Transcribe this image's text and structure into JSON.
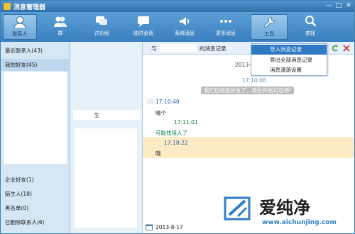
{
  "window": {
    "title": "消息管理器"
  },
  "toolbar": {
    "items": [
      {
        "label": "联系人",
        "icon": "contact-icon"
      },
      {
        "label": "群",
        "icon": "group-icon"
      },
      {
        "label": "讨论组",
        "icon": "discussion-icon"
      },
      {
        "label": "临时会话",
        "icon": "temp-chat-icon"
      },
      {
        "label": "系统消息",
        "icon": "speaker-icon"
      },
      {
        "label": "更多消息",
        "icon": "more-icon"
      },
      {
        "label": "工具",
        "icon": "wrench-icon"
      },
      {
        "label": "查找",
        "icon": "search-icon"
      }
    ]
  },
  "left": {
    "groups_top": [
      {
        "label": "最近联系人(43)"
      },
      {
        "label": "我的好友(45)"
      }
    ],
    "groups_bottom": [
      {
        "label": "企业好友(1)"
      },
      {
        "label": "陌生人(18)"
      },
      {
        "label": "黑名单(0)"
      },
      {
        "label": "已删除联系人(6)"
      }
    ]
  },
  "middle": {
    "contact_suffix": "生"
  },
  "right": {
    "header_prefix": "与",
    "header_suffix": "的消息记录",
    "date_top": "2013-",
    "messages": [
      {
        "time": "17:10:06"
      },
      {
        "system": "我们已经是好友了，现在开始对话吧!"
      },
      {
        "time": "17:10:40",
        "text": "哪个"
      },
      {
        "time": "17:11:01",
        "text": "可能找错人了"
      },
      {
        "time": "17:18:22",
        "text": "哦"
      }
    ],
    "date_bottom": "2013-8-17"
  },
  "tools_menu": {
    "items": [
      "导入消息记录",
      "导出全部消息记录",
      "消息漫游设置"
    ]
  },
  "watermark": {
    "brand": "爱纯净",
    "url": "www.aichunjing.com"
  },
  "colors": {
    "accent": "#3a7fbf",
    "highlight": "#fdebc4",
    "menu_highlight": "#2f79c4",
    "time_green": "#0a7e3a"
  }
}
